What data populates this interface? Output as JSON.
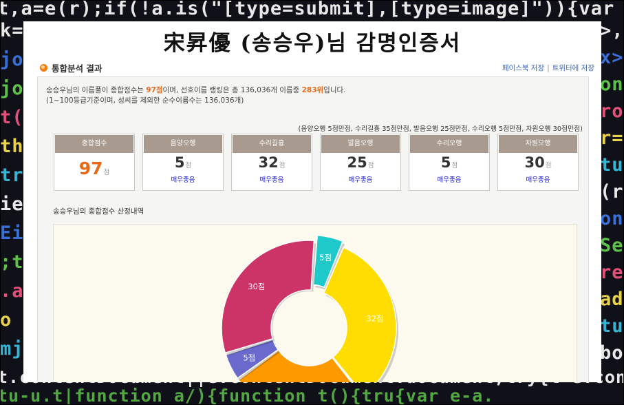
{
  "background_code": [
    {
      "text": "t,a=e(r);if(!a.is(\"[type=submit],[type=image]\")){var n=a.",
      "color": "c-white"
    },
    {
      "text": "t.contentDocument||e.contentDocument.document;try{t=e.contentDocument.document",
      "color": "c-white"
    },
    {
      "text": "tu-u.t|function a/){function t(){tru{var e-a.",
      "color": "c-white"
    }
  ],
  "left_fragments": [
    "k=",
    "jo",
    "jo",
    "t(",
    "th",
    "tr",
    "ie",
    "Ei",
    ";t",
    ".a",
    "o",
    "mj"
  ],
  "right_fragments": [
    ">,",
    "x>",
    "on",
    "ro",
    "r=",
    "tur",
    "(r",
    "on",
    "Se",
    "re",
    "ade",
    "tur",
    "bod"
  ],
  "page": {
    "title": "宋昇優 (송승우)님 감명인증서",
    "section_title": "통합분석 결과",
    "share_facebook": "페이스북 저장",
    "share_separator": "|",
    "share_twitter": "트위터에 저장"
  },
  "summary": {
    "name": "송승우",
    "p1": "님의 이름풀이 종합점수는 ",
    "score_text": "97점",
    "p2": "이며, 선호이름 랭킹은 총 136,036개 이름중 ",
    "rank_text": "283위",
    "p3": "입니다.",
    "line2": "(1~100등급기준이며, 성씨를 제외한 순수이름수는 136,036개)"
  },
  "criteria": "(음양오행 5점만점, 수리길흉 35점만점, 발음오행 25점만점, 수리오행 5점만점, 자원오행 30점만점)",
  "score_boxes": [
    {
      "label": "종합점수",
      "value": "97",
      "unit": "점",
      "grade": ""
    },
    {
      "label": "음양오행",
      "value": "5",
      "unit": "점",
      "grade": "매우좋음"
    },
    {
      "label": "수리길흉",
      "value": "32",
      "unit": "점",
      "grade": "매우좋음"
    },
    {
      "label": "발음오행",
      "value": "25",
      "unit": "점",
      "grade": "매우좋음"
    },
    {
      "label": "수리오행",
      "value": "5",
      "unit": "점",
      "grade": "매우좋음"
    },
    {
      "label": "자원오행",
      "value": "30",
      "unit": "점",
      "grade": "매우좋음"
    }
  ],
  "breakdown_title": "송승우님의 종합점수 산정내역",
  "chart_data": {
    "type": "pie",
    "categories": [
      "음양오행",
      "수리길흉",
      "발음오행",
      "수리오행",
      "자원오행"
    ],
    "values": [
      5,
      32,
      25,
      5,
      30
    ],
    "labels": [
      "5점",
      "32점",
      "25점",
      "5점",
      "30점"
    ],
    "colors": [
      "#1ec9c9",
      "#ffdd00",
      "#ff9900",
      "#6a6acc",
      "#cc3366"
    ],
    "title": "",
    "donut": true
  }
}
